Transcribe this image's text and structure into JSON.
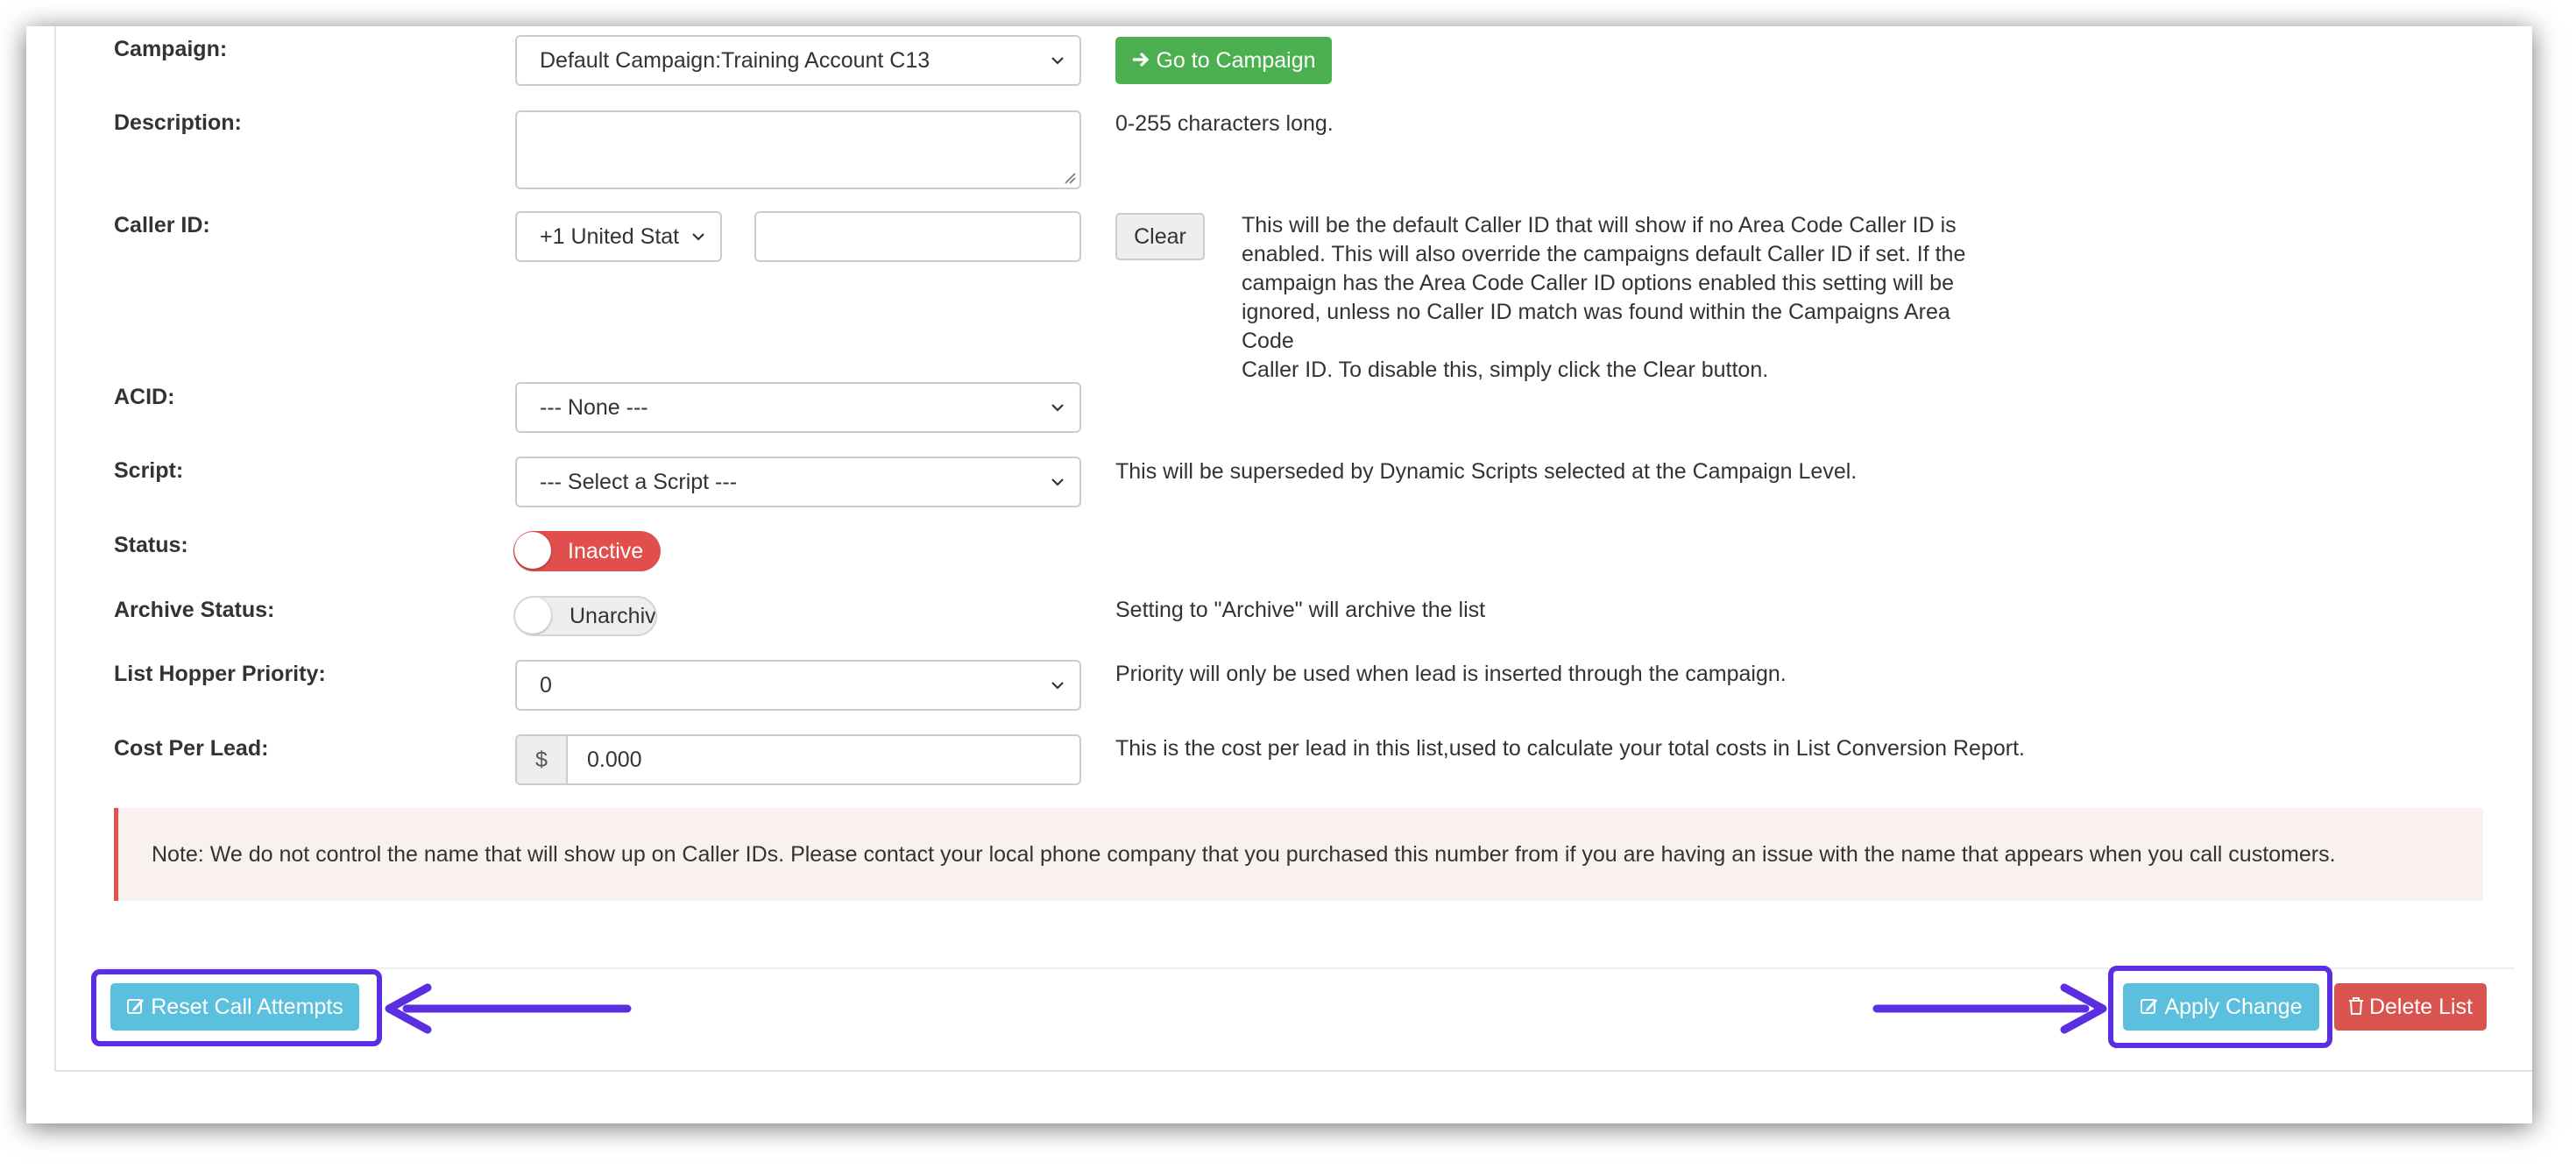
{
  "form": {
    "campaign": {
      "label": "Campaign:",
      "selected": "Default Campaign:Training Account C13",
      "go_button": "Go to Campaign"
    },
    "description": {
      "label": "Description:",
      "value": "",
      "help": "0-255 characters long."
    },
    "caller_id": {
      "label": "Caller ID:",
      "country_selected": "+1 United Stat",
      "number_value": "",
      "clear_button": "Clear",
      "help": "This will be the default Caller ID that will show if no Area Code Caller ID is\nenabled. This will also override the campaigns default Caller ID if set. If the\ncampaign has the Area Code Caller ID options enabled this setting will be\nignored, unless no Caller ID match was found within the Campaigns Area Code\nCaller ID. To disable this, simply click the Clear button."
    },
    "acid": {
      "label": "ACID:",
      "selected": "--- None ---"
    },
    "script": {
      "label": "Script:",
      "selected": "--- Select a Script ---",
      "help": "This will be superseded by Dynamic Scripts selected at the Campaign Level."
    },
    "status": {
      "label": "Status:",
      "toggle_text": "Inactive"
    },
    "archive_status": {
      "label": "Archive Status:",
      "toggle_text": "Unarchive",
      "help": "Setting to \"Archive\" will archive the list"
    },
    "list_hopper_priority": {
      "label": "List Hopper Priority:",
      "selected": "0",
      "help": "Priority will only be used when lead is inserted through the campaign."
    },
    "cost_per_lead": {
      "label": "Cost Per Lead:",
      "currency": "$",
      "value": "0.000",
      "help": "This is the cost per lead in this list,used to calculate your total costs in List Conversion Report."
    }
  },
  "note": "Note: We do not control the name that will show up on Caller IDs. Please contact your local phone company that you purchased this number from if you are having an issue with the name that appears when you call customers.",
  "footer": {
    "reset_button": "Reset Call Attempts",
    "apply_button": "Apply Change",
    "delete_button": "Delete List"
  },
  "colors": {
    "success": "#4cb050",
    "info": "#5bc0de",
    "danger": "#d9534f",
    "toggle_inactive": "#e04f4b",
    "annotation": "#5b2ee0",
    "note_background": "#f8f1f0"
  },
  "icons": {
    "go_button": "arrow-right-icon",
    "reset_button": "edit-icon",
    "apply_button": "edit-icon",
    "delete_button": "trash-icon",
    "selects": "chevron-down-icon"
  }
}
